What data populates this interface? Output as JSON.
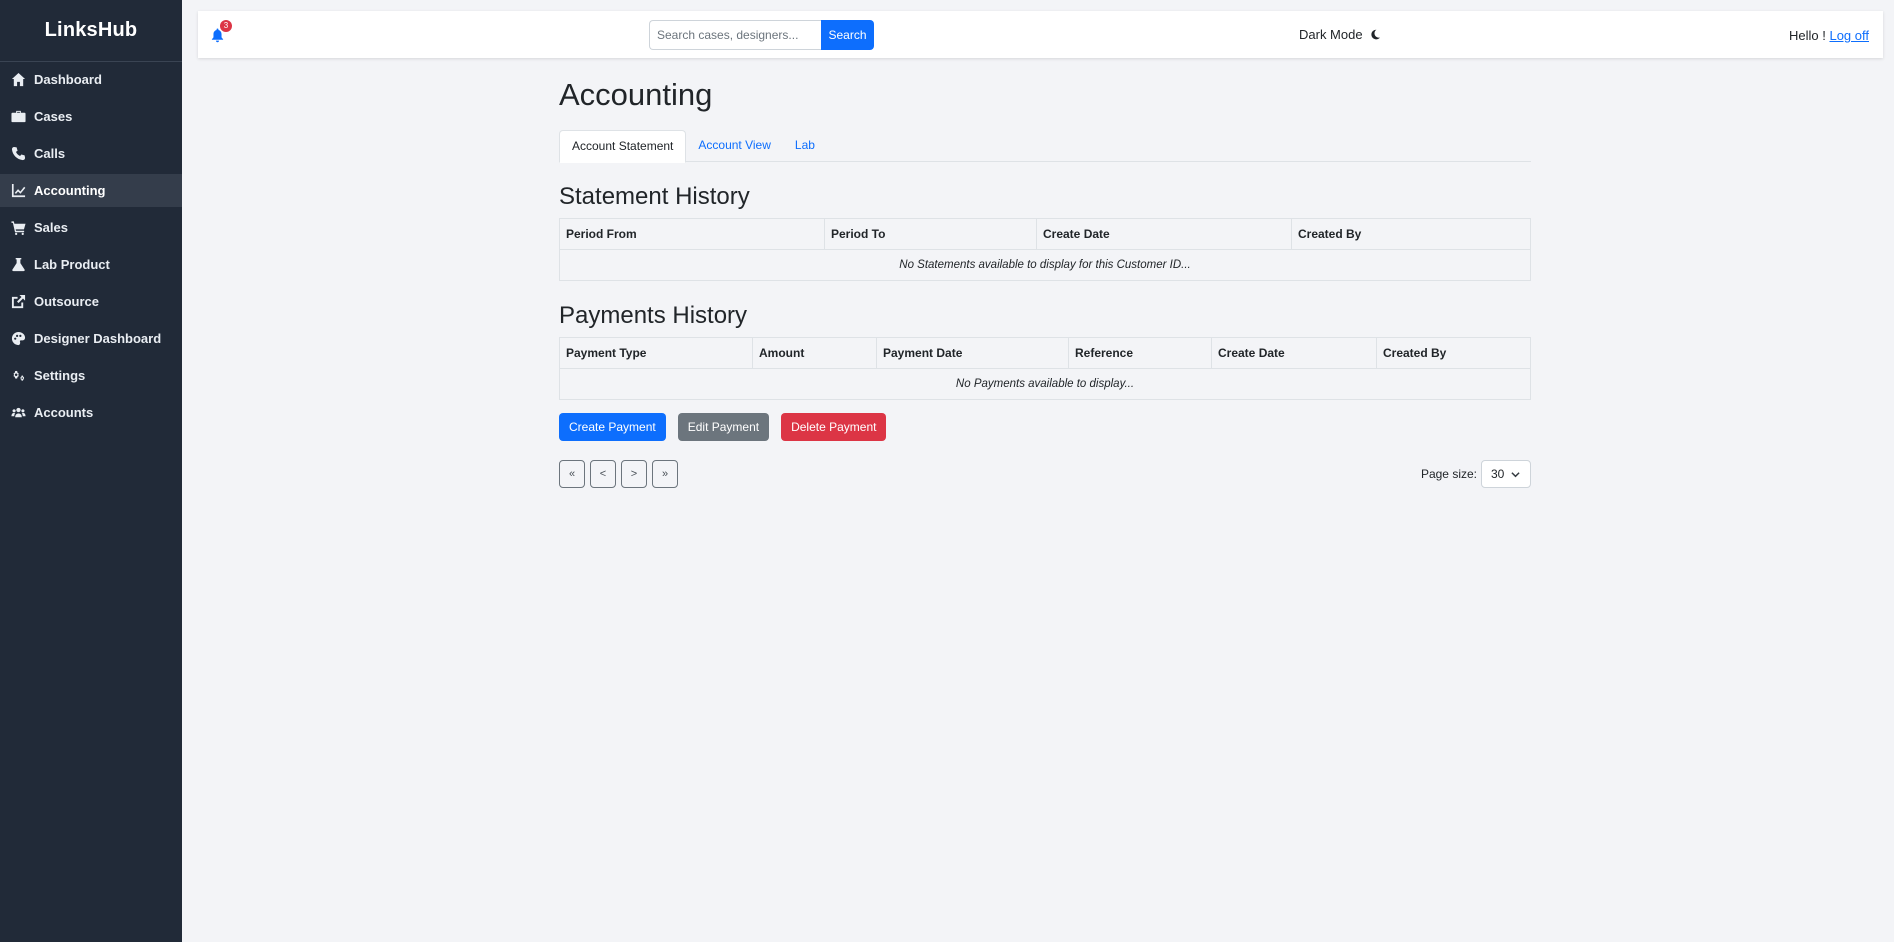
{
  "app": {
    "brand": "LinksHub"
  },
  "sidebar": {
    "items": [
      {
        "label": "Dashboard",
        "icon": "home-icon"
      },
      {
        "label": "Cases",
        "icon": "briefcase-icon"
      },
      {
        "label": "Calls",
        "icon": "phone-icon"
      },
      {
        "label": "Accounting",
        "icon": "chart-line-icon",
        "active": true
      },
      {
        "label": "Sales",
        "icon": "cart-icon"
      },
      {
        "label": "Lab Product",
        "icon": "flask-icon"
      },
      {
        "label": "Outsource",
        "icon": "external-link-icon"
      },
      {
        "label": "Designer Dashboard",
        "icon": "palette-icon"
      },
      {
        "label": "Settings",
        "icon": "gears-icon"
      },
      {
        "label": "Accounts",
        "icon": "users-icon"
      }
    ]
  },
  "topbar": {
    "notifications_count": "3",
    "search_placeholder": "Search cases, designers...",
    "search_value": "",
    "search_button": "Search",
    "dark_mode_label": "Dark Mode",
    "greeting": "Hello ! ",
    "logoff_label": "Log off"
  },
  "page": {
    "title": "Accounting",
    "tabs": [
      {
        "label": "Account Statement",
        "active": true
      },
      {
        "label": "Account View"
      },
      {
        "label": "Lab"
      }
    ]
  },
  "statements": {
    "title": "Statement History",
    "columns": [
      "Period From",
      "Period To",
      "Create Date",
      "Created By"
    ],
    "empty_message": "No Statements available to display for this Customer ID..."
  },
  "payments": {
    "title": "Payments History",
    "columns": [
      "Payment Type",
      "Amount",
      "Payment Date",
      "Reference",
      "Create Date",
      "Created By"
    ],
    "empty_message": "No Payments available to display..."
  },
  "actions": {
    "create": "Create Payment",
    "edit": "Edit Payment",
    "delete": "Delete Payment"
  },
  "pager": {
    "first": "«",
    "prev": "<",
    "next": ">",
    "last": "»",
    "page_size_label": "Page size:",
    "page_size_value": "30"
  },
  "colors": {
    "sidebar_bg": "#212a38",
    "primary": "#0d6efd",
    "secondary": "#6c757d",
    "danger": "#dc3545"
  }
}
